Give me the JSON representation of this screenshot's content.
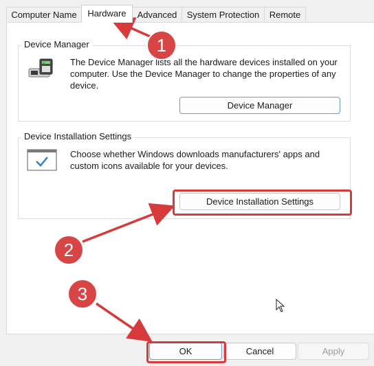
{
  "tabs": [
    {
      "label": "Computer Name"
    },
    {
      "label": "Hardware"
    },
    {
      "label": "Advanced"
    },
    {
      "label": "System Protection"
    },
    {
      "label": "Remote"
    }
  ],
  "device_manager": {
    "title": "Device Manager",
    "description": "The Device Manager lists all the hardware devices installed on your computer. Use the Device Manager to change the properties of any device.",
    "button_label": "Device Manager"
  },
  "device_installation": {
    "title": "Device Installation Settings",
    "description": "Choose whether Windows downloads manufacturers' apps and custom icons available for your devices.",
    "button_label": "Device Installation Settings"
  },
  "footer": {
    "ok_label": "OK",
    "cancel_label": "Cancel",
    "apply_label": "Apply"
  },
  "annotations": {
    "step1": "1",
    "step2": "2",
    "step3": "3",
    "color": "#d63a3a"
  }
}
